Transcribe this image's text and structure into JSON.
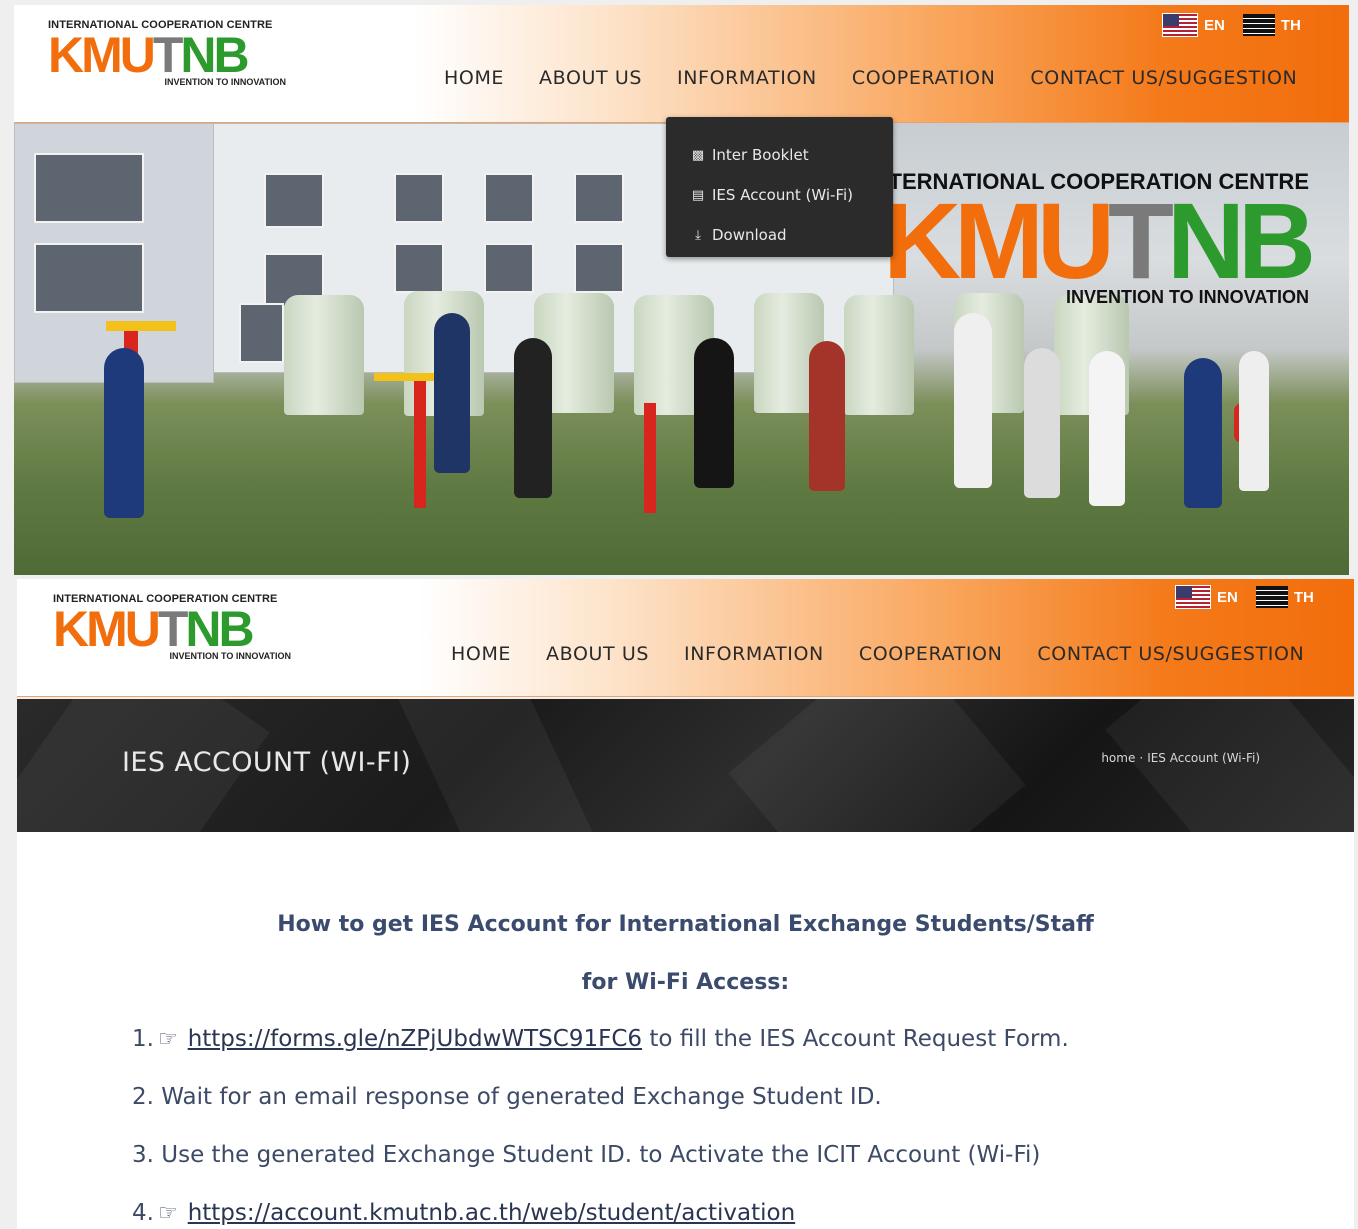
{
  "header": {
    "logo_top": "INTERNATIONAL COOPERATION CENTRE",
    "logo_mark": "KMUTNB",
    "logo_tagline": "INVENTION TO INNOVATION",
    "lang_en": "EN",
    "lang_th": "TH",
    "nav": [
      "HOME",
      "ABOUT US",
      "INFORMATION",
      "COOPERATION",
      "CONTACT US/SUGGESTION"
    ]
  },
  "hero": {
    "logo_top": "INTERNATIONAL COOPERATION CENTRE",
    "logo_mark": "KMUTNB",
    "logo_tagline": "INVENTION TO INNOVATION"
  },
  "dropdown": {
    "items": [
      {
        "icon": "book-icon",
        "label": "Inter Booklet"
      },
      {
        "icon": "id-card-icon",
        "label": "IES Account (Wi-Fi)"
      },
      {
        "icon": "download-icon",
        "label": "Download"
      }
    ]
  },
  "banner": {
    "title": "IES ACCOUNT (WI-FI)",
    "breadcrumb_home": "home",
    "breadcrumb_sep": "·",
    "breadcrumb_current": "IES Account (Wi-Fi)"
  },
  "content": {
    "heading_line1": "How to get IES Account for International Exchange Students/Staff",
    "heading_line2": "for Wi-Fi Access:",
    "steps": [
      {
        "num": "1.",
        "link": "https://forms.gle/nZPjUbdwWTSC91FC6",
        "text": " to fill the IES Account Request Form."
      },
      {
        "num": "2.",
        "text": "Wait for an email response of generated Exchange Student ID."
      },
      {
        "num": "3.",
        "text": "Use the generated Exchange Student ID. to Activate the ICIT Account (Wi-Fi)"
      },
      {
        "num": "4.",
        "link": "https://account.kmutnb.ac.th/web/student/activation"
      }
    ]
  },
  "colors": {
    "orange": "#f26d0c",
    "green": "#2d9a2d",
    "heading": "#3a4b6d"
  }
}
